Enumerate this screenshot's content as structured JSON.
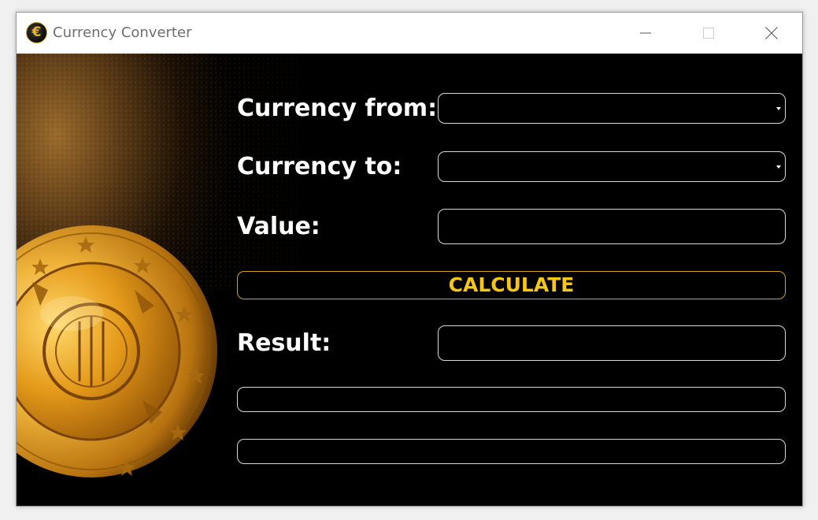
{
  "window": {
    "title": "Currency Converter",
    "icon": "euro-coin-icon",
    "icon_glyph": "€"
  },
  "form": {
    "currency_from_label": "Currency from:",
    "currency_from_value": "",
    "currency_to_label": "Currency to:",
    "currency_to_value": "",
    "value_label": "Value:",
    "value_input": "",
    "calculate_label": "CALCULATE",
    "result_label": "Result:",
    "result_value": "",
    "result_line_1": "",
    "result_line_2": ""
  },
  "colors": {
    "background": "#000000",
    "label_text": "#ffffff",
    "accent_gold": "#f5c518",
    "field_border": "#d8d8d8"
  },
  "background_image": "euro-coin-photo"
}
